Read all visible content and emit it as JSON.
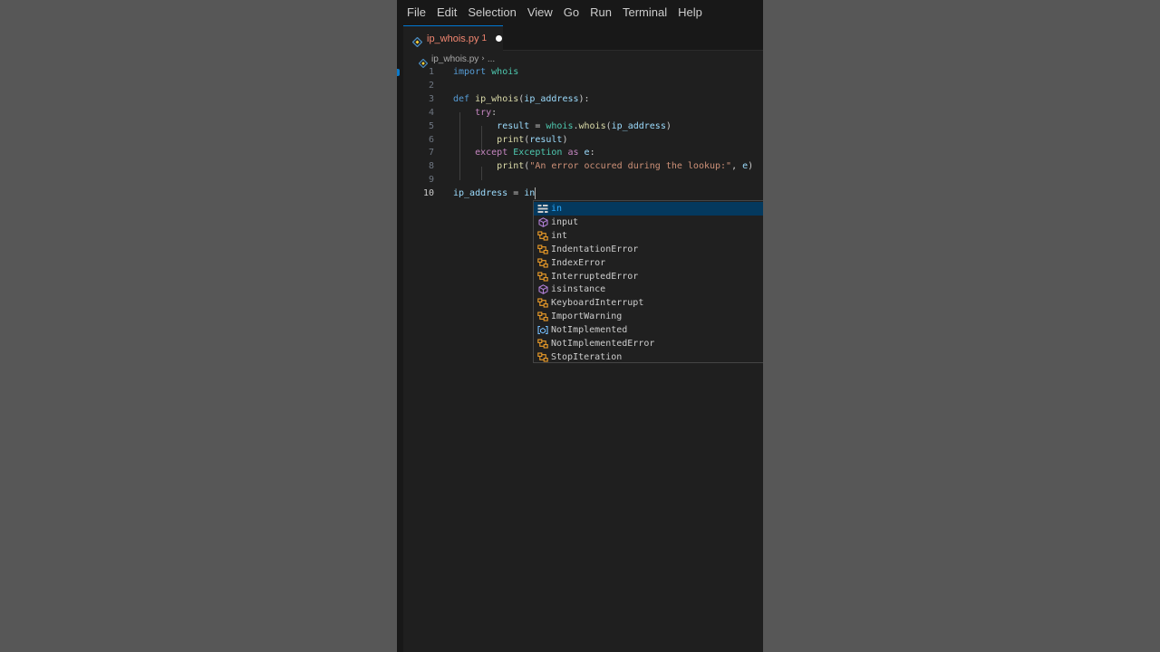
{
  "menubar": {
    "items": [
      "File",
      "Edit",
      "Selection",
      "View",
      "Go",
      "Run",
      "Terminal",
      "Help"
    ]
  },
  "tab": {
    "filename": "ip_whois.py",
    "problem_count": "1",
    "dirty": true
  },
  "breadcrumb": {
    "file": "ip_whois.py",
    "more": "..."
  },
  "editor": {
    "active_line": 10,
    "lines": [
      {
        "number": "1",
        "tokens": [
          [
            "kw",
            "import"
          ],
          [
            "plain",
            " "
          ],
          [
            "mod",
            "whois"
          ]
        ]
      },
      {
        "number": "2",
        "tokens": []
      },
      {
        "number": "3",
        "tokens": [
          [
            "kw",
            "def"
          ],
          [
            "plain",
            " "
          ],
          [
            "fn",
            "ip_whois"
          ],
          [
            "plain",
            "("
          ],
          [
            "var",
            "ip_address"
          ],
          [
            "plain",
            "):"
          ]
        ]
      },
      {
        "number": "4",
        "tokens": [
          [
            "plain",
            "    "
          ],
          [
            "ctrl",
            "try"
          ],
          [
            "plain",
            ":"
          ]
        ]
      },
      {
        "number": "5",
        "tokens": [
          [
            "plain",
            "        "
          ],
          [
            "var",
            "result"
          ],
          [
            "plain",
            " = "
          ],
          [
            "mod",
            "whois"
          ],
          [
            "plain",
            "."
          ],
          [
            "fn",
            "whois"
          ],
          [
            "plain",
            "("
          ],
          [
            "var",
            "ip_address"
          ],
          [
            "plain",
            ")"
          ]
        ]
      },
      {
        "number": "6",
        "tokens": [
          [
            "plain",
            "        "
          ],
          [
            "fn",
            "print"
          ],
          [
            "plain",
            "("
          ],
          [
            "var",
            "result"
          ],
          [
            "plain",
            ")"
          ]
        ]
      },
      {
        "number": "7",
        "tokens": [
          [
            "plain",
            "    "
          ],
          [
            "ctrl",
            "except"
          ],
          [
            "plain",
            " "
          ],
          [
            "cls",
            "Exception"
          ],
          [
            "plain",
            " "
          ],
          [
            "ctrl",
            "as"
          ],
          [
            "plain",
            " "
          ],
          [
            "var",
            "e"
          ],
          [
            "plain",
            ":"
          ]
        ]
      },
      {
        "number": "8",
        "tokens": [
          [
            "plain",
            "        "
          ],
          [
            "fn",
            "print"
          ],
          [
            "plain",
            "("
          ],
          [
            "str",
            "\"An error occured during the lookup:\""
          ],
          [
            "plain",
            ", "
          ],
          [
            "var",
            "e"
          ],
          [
            "plain",
            ")"
          ]
        ]
      },
      {
        "number": "9",
        "tokens": []
      },
      {
        "number": "10",
        "tokens": [
          [
            "var",
            "ip_address"
          ],
          [
            "plain",
            " = "
          ],
          [
            "var",
            "in"
          ]
        ]
      }
    ]
  },
  "suggestions": {
    "selected_index": 0,
    "items": [
      {
        "label": "in",
        "kind": "keyword-icon",
        "color": "#cccccc"
      },
      {
        "label": "input",
        "kind": "method-icon",
        "color": "#b180d7"
      },
      {
        "label": "int",
        "kind": "class-icon",
        "color": "#ee9d28"
      },
      {
        "label": "IndentationError",
        "kind": "class-icon",
        "color": "#ee9d28"
      },
      {
        "label": "IndexError",
        "kind": "class-icon",
        "color": "#ee9d28"
      },
      {
        "label": "InterruptedError",
        "kind": "class-icon",
        "color": "#ee9d28"
      },
      {
        "label": "isinstance",
        "kind": "method-icon",
        "color": "#b180d7"
      },
      {
        "label": "KeyboardInterrupt",
        "kind": "class-icon",
        "color": "#ee9d28"
      },
      {
        "label": "ImportWarning",
        "kind": "class-icon",
        "color": "#ee9d28"
      },
      {
        "label": "NotImplemented",
        "kind": "variable-icon",
        "color": "#75beff"
      },
      {
        "label": "NotImplementedError",
        "kind": "class-icon",
        "color": "#ee9d28"
      },
      {
        "label": "StopIteration",
        "kind": "class-icon",
        "color": "#ee9d28"
      }
    ]
  }
}
